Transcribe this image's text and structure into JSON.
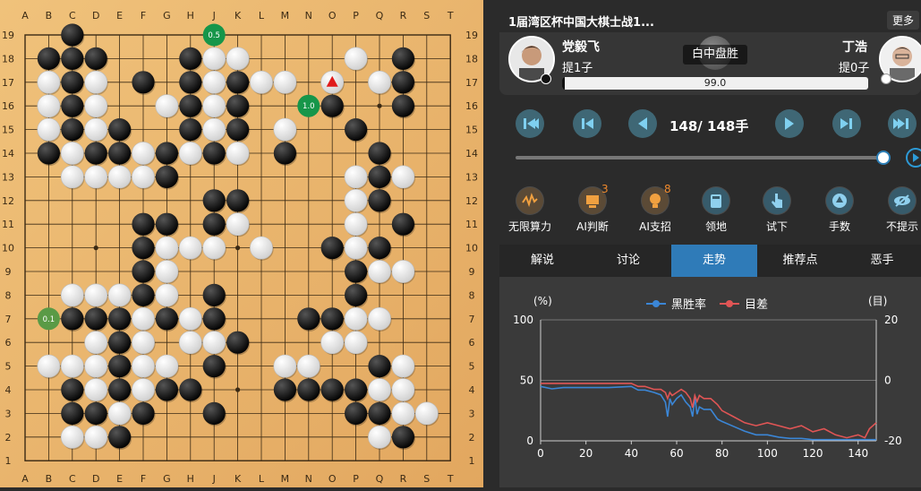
{
  "board": {
    "col_labels": [
      "A",
      "B",
      "C",
      "D",
      "E",
      "F",
      "G",
      "H",
      "J",
      "K",
      "L",
      "M",
      "N",
      "O",
      "P",
      "Q",
      "R",
      "S",
      "T"
    ],
    "row_labels": [
      "19",
      "18",
      "17",
      "16",
      "15",
      "14",
      "13",
      "12",
      "11",
      "10",
      "9",
      "8",
      "7",
      "6",
      "5",
      "4",
      "3",
      "2",
      "1"
    ],
    "black_stones": [
      "C19",
      "H18",
      "B18",
      "C18",
      "D18",
      "R18",
      "C17",
      "F17",
      "H17",
      "K17",
      "R17",
      "C16",
      "H16",
      "K16",
      "O16",
      "R16",
      "C15",
      "E15",
      "H15",
      "K15",
      "P15",
      "B14",
      "D14",
      "E14",
      "G14",
      "J14",
      "M14",
      "Q14",
      "G13",
      "Q13",
      "J12",
      "K12",
      "Q12",
      "F11",
      "G11",
      "J11",
      "R11",
      "F10",
      "O10",
      "Q10",
      "F9",
      "P9",
      "F8",
      "J8",
      "P8",
      "C7",
      "D7",
      "E7",
      "G7",
      "J7",
      "N7",
      "O7",
      "E6",
      "K6",
      "E5",
      "J5",
      "Q5",
      "C4",
      "E4",
      "G4",
      "H4",
      "M4",
      "N4",
      "O4",
      "P4",
      "C3",
      "D3",
      "F3",
      "J3",
      "P3",
      "Q3",
      "E2",
      "R2"
    ],
    "white_stones": [
      "J18",
      "K18",
      "P18",
      "B17",
      "D17",
      "J17",
      "L17",
      "M17",
      "Q17",
      "B16",
      "D16",
      "G16",
      "J16",
      "B15",
      "D15",
      "J15",
      "M15",
      "C14",
      "F14",
      "H14",
      "K14",
      "C13",
      "D13",
      "E13",
      "F13",
      "P13",
      "R13",
      "P12",
      "K11",
      "P11",
      "G10",
      "H10",
      "J10",
      "L10",
      "P10",
      "G9",
      "Q9",
      "R9",
      "C8",
      "D8",
      "E8",
      "G8",
      "F7",
      "H7",
      "P7",
      "Q7",
      "D6",
      "F6",
      "H6",
      "J6",
      "O6",
      "P6",
      "B5",
      "C5",
      "D5",
      "F5",
      "G5",
      "M5",
      "N5",
      "R5",
      "D4",
      "F4",
      "Q4",
      "R4",
      "E3",
      "R3",
      "S3",
      "C2",
      "D2",
      "Q2"
    ],
    "star_points": [
      "D16",
      "K16",
      "Q16",
      "D10",
      "K10",
      "Q10",
      "D4",
      "K4",
      "Q4"
    ],
    "last_move": "O17",
    "score_markers": [
      {
        "pos": "J19",
        "text": "0.5"
      },
      {
        "pos": "N16",
        "text": "1.0"
      },
      {
        "pos": "B7",
        "text": "0.1"
      }
    ]
  },
  "header": {
    "title": "1届湾区杯中国大棋士战1...",
    "more_label": "更多"
  },
  "players": {
    "black": {
      "name": "党毅飞",
      "captures": "提1子"
    },
    "white": {
      "name": "丁浩",
      "captures": "提0子"
    },
    "result": "白中盘胜",
    "winrate_value": "99.0",
    "winrate_fraction": 0.99
  },
  "navigation": {
    "move_counter": "148/ 148手",
    "slider_fraction": 1.0
  },
  "tools": [
    {
      "label": "无限算力",
      "count": "",
      "icon": "cpu-icon"
    },
    {
      "label": "AI判断",
      "count": "3",
      "icon": "ai-judge-icon"
    },
    {
      "label": "AI支招",
      "count": "8",
      "icon": "lightbulb-icon"
    },
    {
      "label": "领地",
      "count": "",
      "icon": "territory-icon"
    },
    {
      "label": "试下",
      "count": "",
      "icon": "hand-icon"
    },
    {
      "label": "手数",
      "count": "",
      "icon": "move-number-icon"
    },
    {
      "label": "不提示",
      "count": "",
      "icon": "eye-icon"
    }
  ],
  "tabs": [
    "解说",
    "讨论",
    "走势",
    "推荐点",
    "恶手"
  ],
  "active_tab": "走势",
  "colors": {
    "black_winrate": "#3b86d6",
    "score_diff": "#e05555",
    "board": "#e9b26a",
    "tab_active": "#2f7bb8"
  },
  "chart_data": {
    "type": "line",
    "left_axis_unit": "(%)",
    "right_axis_unit": "(目)",
    "x_ticks": [
      0,
      20,
      40,
      60,
      80,
      100,
      120,
      140
    ],
    "y_left_ticks": [
      0,
      50,
      100
    ],
    "y_right_ticks": [
      20,
      0,
      -20
    ],
    "xlim": [
      0,
      148
    ],
    "ylim_left": [
      0,
      100
    ],
    "ylim_right": [
      -20,
      20
    ],
    "series": [
      {
        "name": "黑胜率",
        "axis": "left",
        "x": [
          0,
          5,
          10,
          20,
          30,
          40,
          43,
          46,
          50,
          53,
          55,
          56,
          57,
          58,
          60,
          62,
          64,
          66,
          67,
          68,
          69,
          70,
          72,
          75,
          78,
          80,
          85,
          90,
          95,
          100,
          105,
          110,
          115,
          120,
          125,
          130,
          140,
          145,
          148
        ],
        "y": [
          45,
          43,
          44,
          44,
          44,
          45,
          42,
          42,
          40,
          38,
          32,
          20,
          35,
          30,
          35,
          38,
          32,
          28,
          20,
          36,
          22,
          28,
          26,
          26,
          18,
          16,
          12,
          8,
          5,
          5,
          3,
          2,
          2,
          1,
          1,
          1,
          1,
          1,
          1
        ]
      },
      {
        "name": "目差",
        "axis": "right",
        "x": [
          0,
          5,
          10,
          20,
          30,
          40,
          43,
          46,
          50,
          53,
          55,
          56,
          57,
          58,
          60,
          62,
          64,
          66,
          67,
          68,
          69,
          70,
          72,
          75,
          78,
          80,
          85,
          90,
          95,
          100,
          105,
          110,
          115,
          120,
          125,
          130,
          135,
          140,
          143,
          145,
          148
        ],
        "y": [
          -1,
          -1,
          -1,
          -1,
          -1,
          -1,
          -2,
          -2,
          -3,
          -3,
          -4,
          -6,
          -4,
          -5,
          -4,
          -3,
          -4,
          -6,
          -9,
          -5,
          -7,
          -5,
          -6,
          -6,
          -8,
          -10,
          -12,
          -14,
          -15,
          -14,
          -15,
          -16,
          -15,
          -17,
          -16,
          -18,
          -19,
          -18,
          -19,
          -16,
          -14
        ]
      }
    ]
  }
}
